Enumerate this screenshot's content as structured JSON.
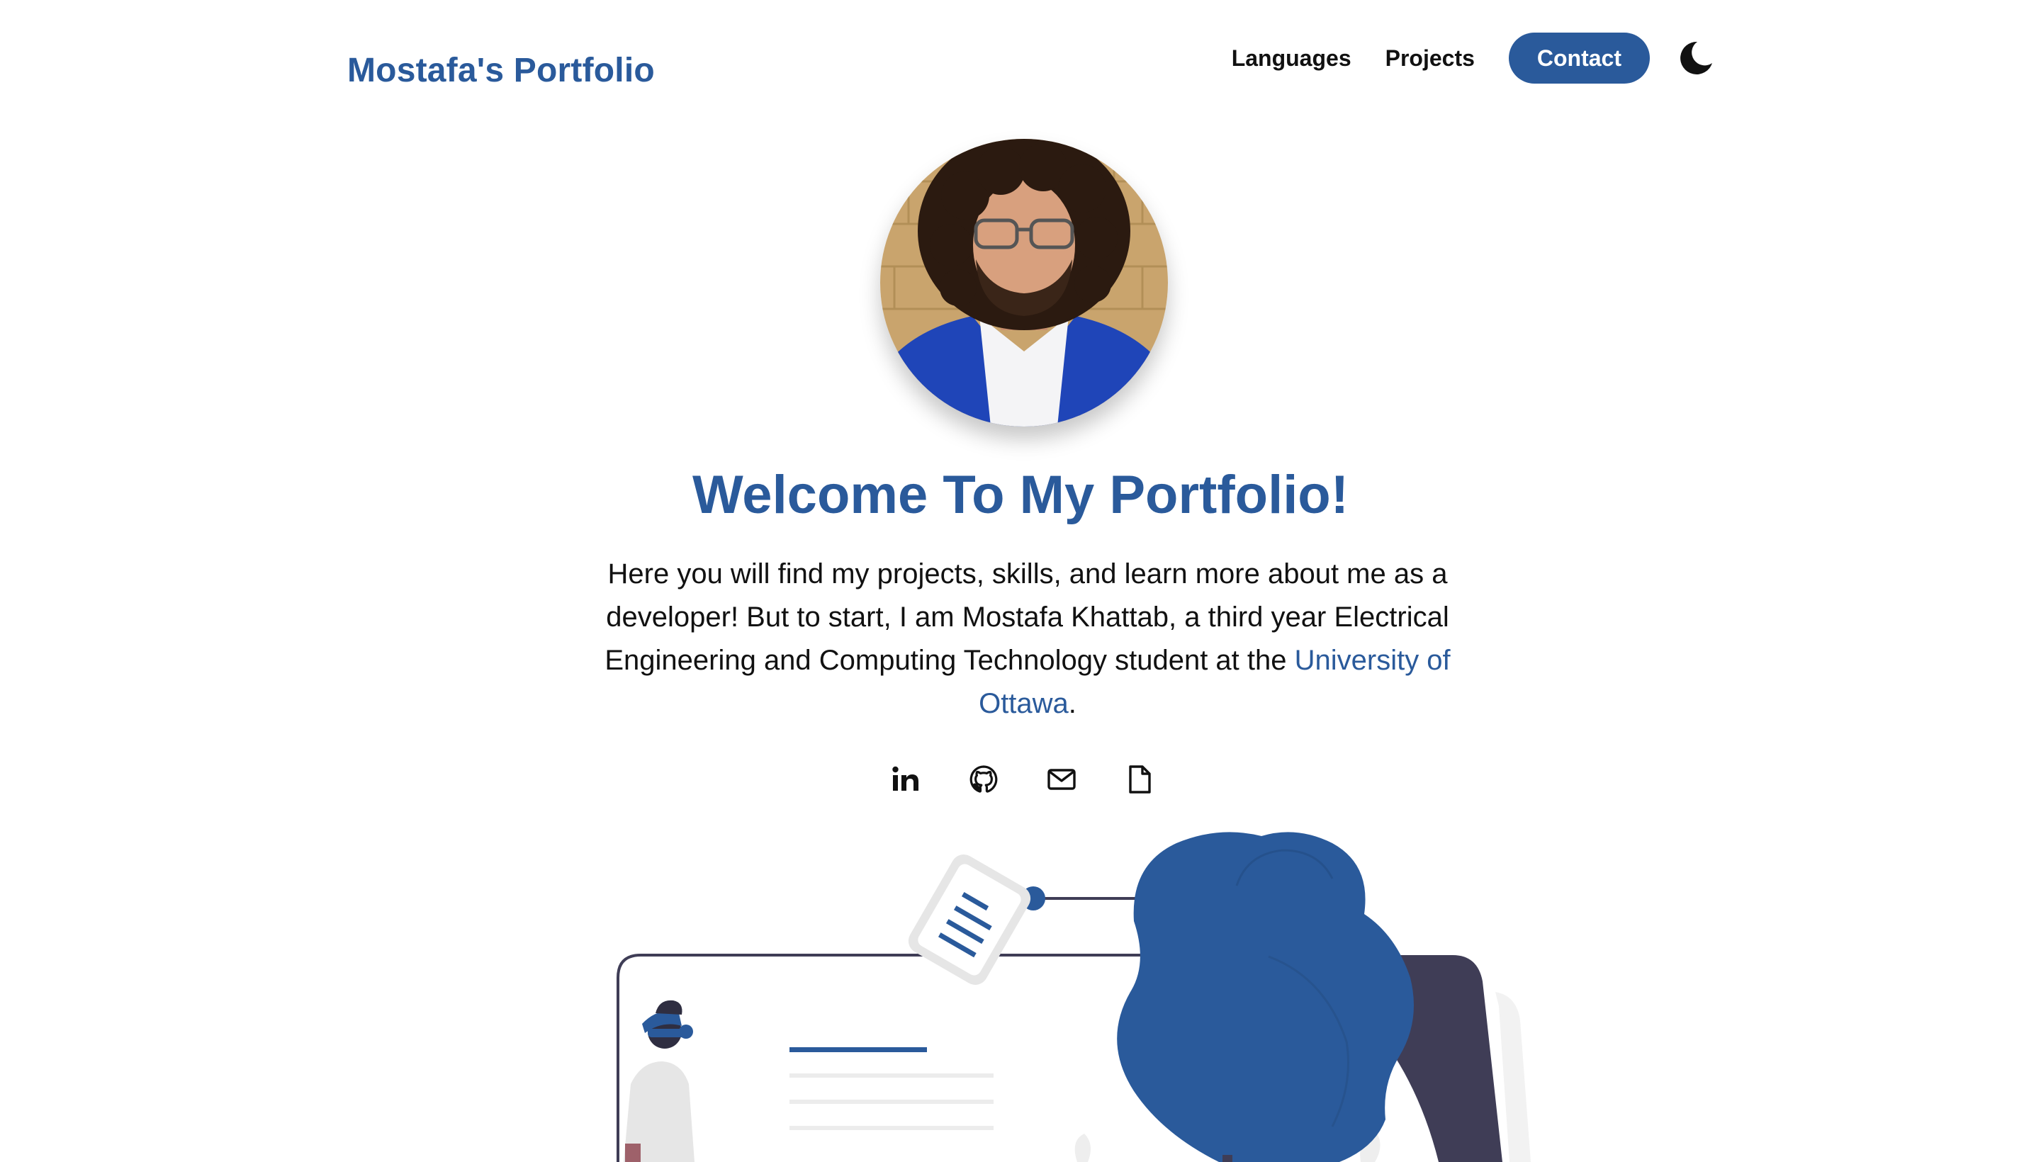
{
  "nav": {
    "brand": "Mostafa's Portfolio",
    "links": [
      "Languages",
      "Projects"
    ],
    "contact_label": "Contact",
    "theme_toggle_icon": "moon-icon"
  },
  "hero": {
    "title": "Welcome To My Portfolio!",
    "intro": "Here you will find my projects, skills, and learn more about me as a developer! But to start, I am Mostafa Khattab, a third year Electrical Engineering and Computing Technology student at the ",
    "university_link": "University of Ottawa",
    "intro_end": "."
  },
  "socials": [
    {
      "icon": "linkedin-icon"
    },
    {
      "icon": "github-icon"
    },
    {
      "icon": "mail-icon"
    },
    {
      "icon": "resume-file-icon"
    }
  ],
  "colors": {
    "accent": "#2a5a9b",
    "text": "#111111",
    "background": "#ffffff",
    "illustration_dark": "#3f3d56"
  }
}
